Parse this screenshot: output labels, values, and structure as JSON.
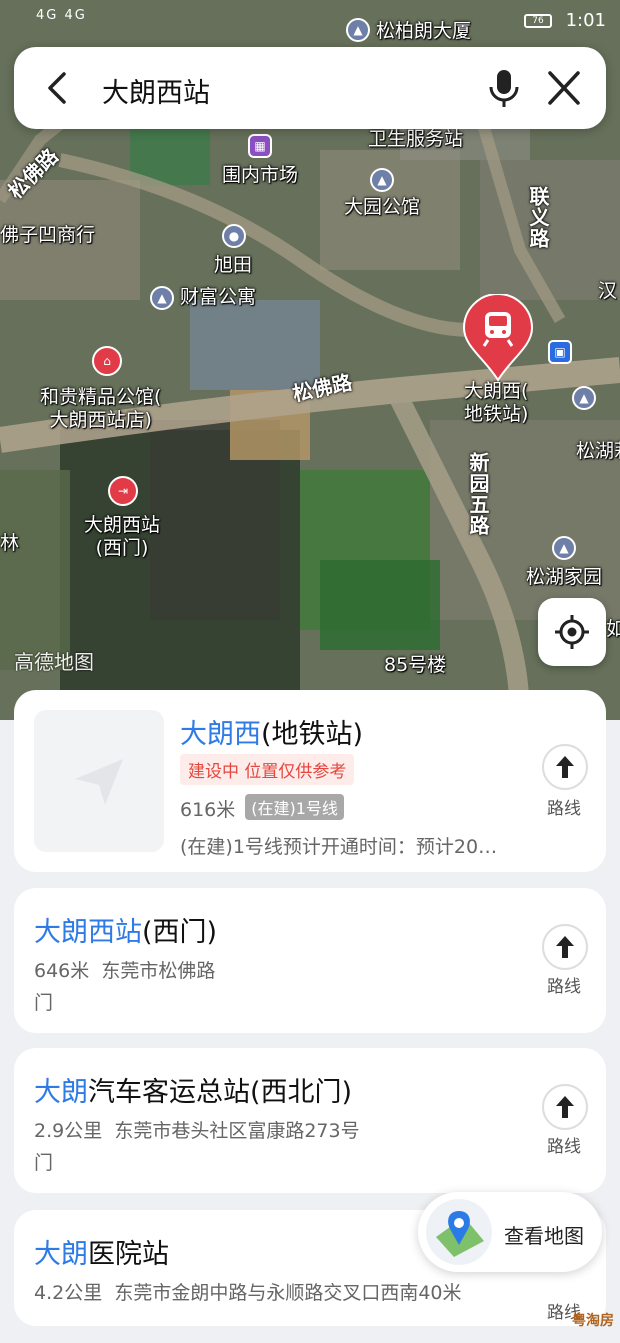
{
  "status_bar": {
    "left": "4G 4G",
    "battery": "76",
    "time": "1:01"
  },
  "search": {
    "query": "大朗西站"
  },
  "map": {
    "logo": "高德地图",
    "labels": {
      "songbolang": "松柏朗大厦",
      "weisheng": "卫生服务站",
      "weinei": "围内市场",
      "dayuan": "大园公馆",
      "xutian": "旭田",
      "caifu": "财富公寓",
      "fozi": "佛子凹商行",
      "hegui": "和贵精品公馆(\n大朗西站店)",
      "dalangxi_west": "大朗西站\n(西门)",
      "metro": "大朗西(\n地铁站)",
      "songhu_home": "松湖家园",
      "songhu": "松湖莉",
      "bldg85": "85号楼",
      "han": "汉",
      "lin": "林",
      "ru": "如"
    },
    "roads": {
      "songfo_main": "松佛路",
      "songfo_left": "松佛路",
      "lianyi": "联义路",
      "xinyuan": "新园五路"
    }
  },
  "results": [
    {
      "title_hl": "大朗西",
      "title_rest": "(地铁站)",
      "warning": "建设中 位置仅供参考",
      "distance": "616米",
      "line_tag": "(在建)1号线",
      "extra": "(在建)1号线预计开通时间：预计20…",
      "route_label": "路线"
    },
    {
      "title_hl": "大朗西站",
      "title_rest": "(西门)",
      "distance": "646米",
      "address": "东莞市松佛路",
      "address2": "门",
      "route_label": "路线"
    },
    {
      "title_hl": "大朗",
      "title_rest": "汽车客运总站(西北门)",
      "distance": "2.9公里",
      "address": "东莞市巷头社区富康路273号",
      "address2": "门",
      "route_label": "路线"
    },
    {
      "title_hl": "大朗",
      "title_rest": "医院站",
      "distance": "4.2公里",
      "address": "东莞市金朗中路与永顺路交叉口西南40米",
      "route_label": "路线"
    }
  ],
  "view_map": {
    "label": "查看地图"
  },
  "watermark": "粤淘房",
  "colors": {
    "highlight": "#2f7be6",
    "warning": "#e5473f",
    "metro_red": "#e23b48"
  }
}
